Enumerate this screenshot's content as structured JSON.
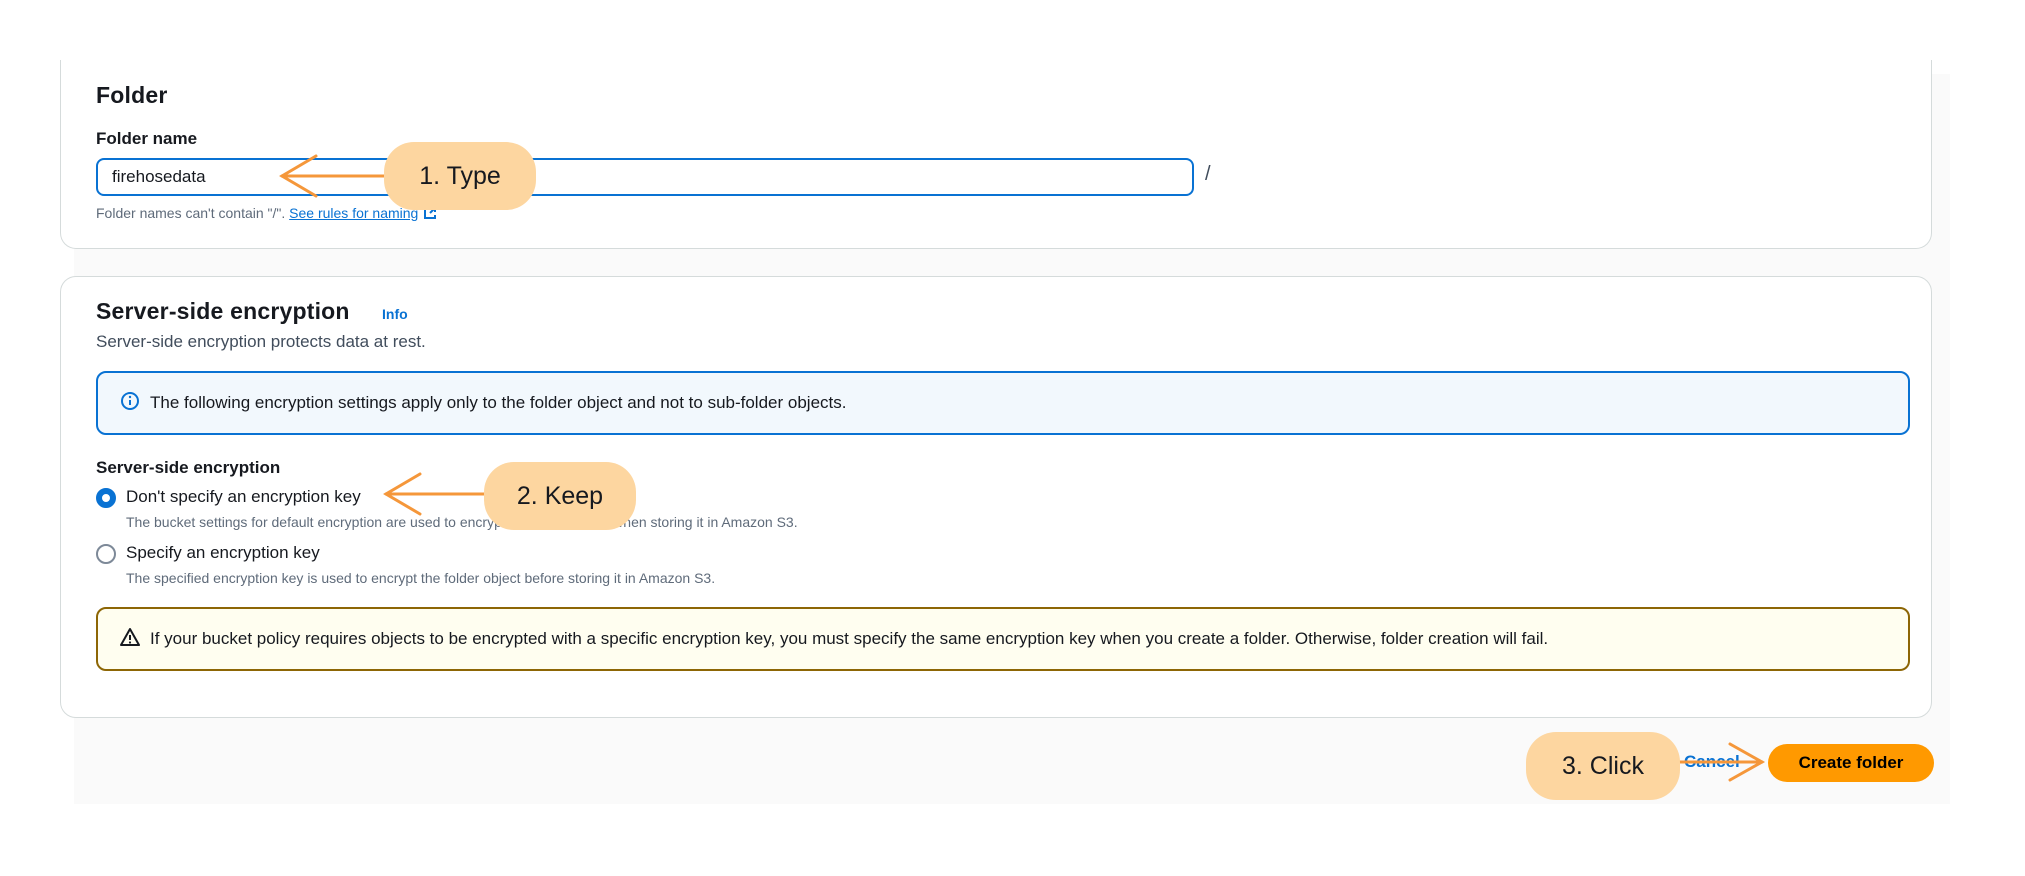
{
  "folder": {
    "heading": "Folder",
    "name_label": "Folder name",
    "name_value": "firehosedata",
    "suffix": "/",
    "hint_prefix": "Folder names can't contain \"/\".",
    "hint_link": "See rules for naming"
  },
  "encryption": {
    "heading": "Server-side encryption",
    "info_link": "Info",
    "description": "Server-side encryption protects data at rest.",
    "info_message": "The following encryption settings apply only to the folder object and not to sub-folder objects.",
    "group_label": "Server-side encryption",
    "options": [
      {
        "label": "Don't specify an encryption key",
        "description": "The bucket settings for default encryption are used to encrypt the folder object when storing it in Amazon S3.",
        "selected": true
      },
      {
        "label": "Specify an encryption key",
        "description": "The specified encryption key is used to encrypt the folder object before storing it in Amazon S3.",
        "selected": false
      }
    ],
    "warning_message": "If your bucket policy requires objects to be encrypted with a specific encryption key, you must specify the same encryption key when you create a folder. Otherwise, folder creation will fail."
  },
  "actions": {
    "cancel_label": "Cancel",
    "create_label": "Create folder"
  },
  "annotations": {
    "step1": "1. Type",
    "step2": "2. Keep",
    "step3": "3. Click"
  },
  "colors": {
    "accent": "#0972d3",
    "primary_button": "#ff9900",
    "callout_bg": "#fdd6a0",
    "arrow": "#f5973a",
    "warning_border": "#8d6605",
    "info_bg": "#f2f8fd"
  },
  "icons": {
    "info": "info-circle-icon",
    "warning": "warning-triangle-icon",
    "external": "external-link-icon"
  }
}
